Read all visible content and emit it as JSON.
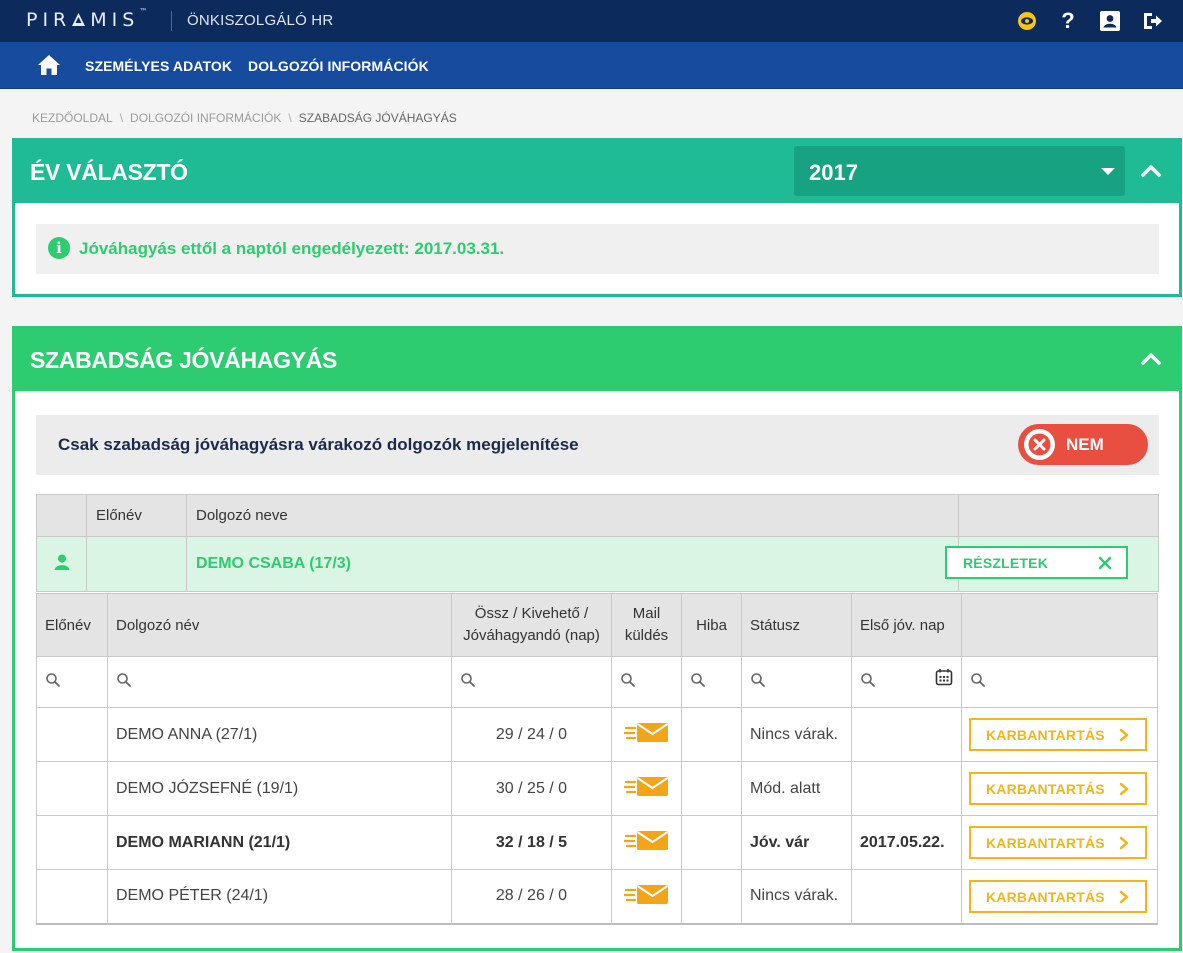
{
  "header": {
    "logo": "PIR",
    "logo_rest": "MIS",
    "logo_tm": "™",
    "app_title": "ÖNKISZOLGÁLÓ HR",
    "icons": [
      "eye-icon",
      "help-icon",
      "profile-icon",
      "logout-icon"
    ],
    "help_glyph": "?"
  },
  "nav": {
    "items": [
      "SZEMÉLYES ADATOK",
      "DOLGOZÓI INFORMÁCIÓK"
    ]
  },
  "breadcrumb": {
    "items": [
      "KEZDŐOLDAL",
      "DOLGOZÓI INFORMÁCIÓK",
      "SZABADSÁG JÓVÁHAGYÁS"
    ],
    "separator": "\\"
  },
  "year_panel": {
    "title": "ÉV VÁLASZTÓ",
    "selected_year": "2017",
    "info_icon": "i",
    "info_text": "Jóváhagyás ettől a naptól engedélyezett: 2017.03.31."
  },
  "approval_panel": {
    "title": "SZABADSÁG JÓVÁHAGYÁS",
    "filter_text": "Csak szabadság jóváhagyásra várakozó dolgozók megjelenítése",
    "toggle_label": "NEM",
    "outer_headers": [
      "",
      "Előnév",
      "Dolgozó neve",
      ""
    ],
    "group": {
      "name": "DEMO CSABA (17/3)",
      "details_label": "RÉSZLETEK",
      "close_glyph": "✕"
    },
    "inner_headers": {
      "prefix": "Előnév",
      "name": "Dolgozó név",
      "totals_line1": "Össz / Kivehető /",
      "totals_line2": "Jóváhagyandó (nap)",
      "mail_line1": "Mail",
      "mail_line2": "küldés",
      "error": "Hiba",
      "status": "Státusz",
      "first_day": "Első jóv. nap"
    },
    "rows": [
      {
        "name": "DEMO ANNA (27/1)",
        "totals": "29 / 24 / 0",
        "status": "Nincs várak.",
        "first_day": "",
        "action": "KARBANTARTÁS"
      },
      {
        "name": "DEMO JÓZSEFNÉ (19/1)",
        "totals": "30 / 25 / 0",
        "status": "Mód. alatt",
        "first_day": "",
        "action": "KARBANTARTÁS"
      },
      {
        "name": "DEMO MARIANN (21/1)",
        "totals": "32 / 18 / 5",
        "status": "Jóv. vár",
        "first_day": "2017.05.22.",
        "action": "KARBANTARTÁS"
      },
      {
        "name": "DEMO PÉTER (24/1)",
        "totals": "28 / 26 / 0",
        "status": "Nincs várak.",
        "first_day": "",
        "action": "KARBANTARTÁS"
      }
    ]
  },
  "colors": {
    "topbar": "#0c2a5c",
    "navbar": "#174b9e",
    "year_green": "#1ebb95",
    "approval_green": "#2ecc71",
    "toggle_red": "#e94f40",
    "maint_orange": "#f2b51b"
  }
}
